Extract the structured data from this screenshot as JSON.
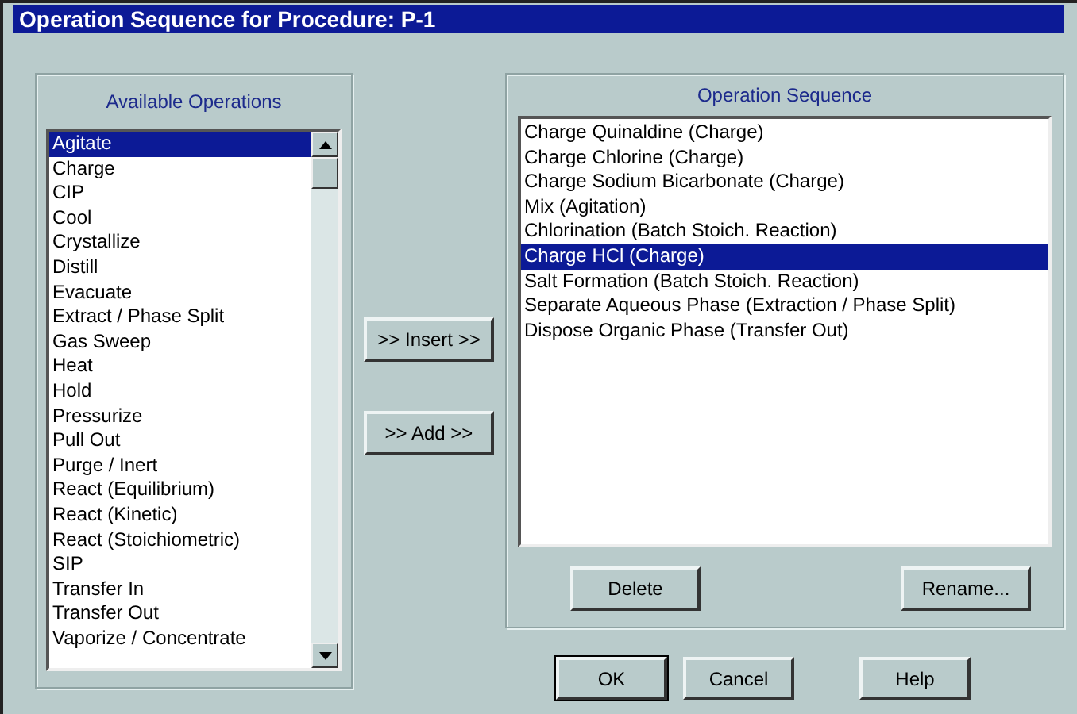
{
  "window": {
    "title": "Operation Sequence for Procedure: P-1"
  },
  "available_operations": {
    "label": "Available Operations",
    "items": [
      {
        "label": "Agitate",
        "selected": true
      },
      {
        "label": "Charge",
        "selected": false
      },
      {
        "label": "CIP",
        "selected": false
      },
      {
        "label": "Cool",
        "selected": false
      },
      {
        "label": "Crystallize",
        "selected": false
      },
      {
        "label": "Distill",
        "selected": false
      },
      {
        "label": "Evacuate",
        "selected": false
      },
      {
        "label": "Extract / Phase Split",
        "selected": false
      },
      {
        "label": "Gas Sweep",
        "selected": false
      },
      {
        "label": "Heat",
        "selected": false
      },
      {
        "label": "Hold",
        "selected": false
      },
      {
        "label": "Pressurize",
        "selected": false
      },
      {
        "label": "Pull Out",
        "selected": false
      },
      {
        "label": "Purge / Inert",
        "selected": false
      },
      {
        "label": "React (Equilibrium)",
        "selected": false
      },
      {
        "label": "React (Kinetic)",
        "selected": false
      },
      {
        "label": "React (Stoichiometric)",
        "selected": false
      },
      {
        "label": "SIP",
        "selected": false
      },
      {
        "label": "Transfer In",
        "selected": false
      },
      {
        "label": "Transfer Out",
        "selected": false
      },
      {
        "label": "Vaporize / Concentrate",
        "selected": false
      }
    ]
  },
  "transfer_buttons": [
    ">> Insert >>",
    ">> Add >>"
  ],
  "operation_sequence": {
    "label": "Operation Sequence",
    "items": [
      {
        "label": "Charge Quinaldine (Charge)",
        "selected": false
      },
      {
        "label": "Charge Chlorine (Charge)",
        "selected": false
      },
      {
        "label": "Charge Sodium Bicarbonate (Charge)",
        "selected": false
      },
      {
        "label": "Mix (Agitation)",
        "selected": false
      },
      {
        "label": "Chlorination (Batch Stoich. Reaction)",
        "selected": false
      },
      {
        "label": "Charge HCl (Charge)",
        "selected": true
      },
      {
        "label": "Salt Formation (Batch Stoich. Reaction)",
        "selected": false
      },
      {
        "label": "Separate Aqueous Phase (Extraction / Phase Split)",
        "selected": false
      },
      {
        "label": "Dispose Organic Phase (Transfer Out)",
        "selected": false
      }
    ],
    "buttons": [
      "Delete",
      "Rename..."
    ]
  },
  "buttons": [
    {
      "label": "OK",
      "default": true
    },
    {
      "label": "Cancel",
      "default": false
    },
    {
      "label": "Help",
      "default": false
    }
  ]
}
